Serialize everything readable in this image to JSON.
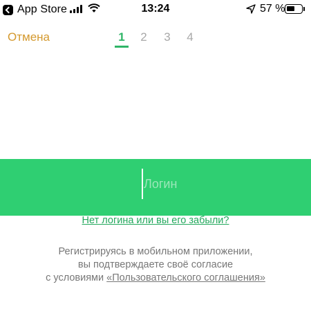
{
  "status_bar": {
    "back_app_label": "App Store",
    "time": "13:24",
    "battery_percent": "57 %",
    "battery_level": 0.57,
    "icons": [
      "back-icon",
      "signal-icon",
      "wifi-icon",
      "location-arrow-icon",
      "battery-icon"
    ]
  },
  "nav": {
    "cancel_label": "Отмена",
    "steps": [
      "1",
      "2",
      "3",
      "4"
    ],
    "active_step": 1
  },
  "login": {
    "placeholder": "Логин"
  },
  "forgot_link": "Нет логина или вы его забыли?",
  "terms": {
    "line1": "Регистрируясь в мобильном приложении,",
    "line2": "вы подтверждаете  своё согласие",
    "line3_prefix": "с условиями ",
    "line3_link": "«Пользовательского соглашения»"
  },
  "colors": {
    "accent_green": "#2fcf72",
    "link_green": "#22a85c",
    "cancel_orange": "#d4992e"
  }
}
